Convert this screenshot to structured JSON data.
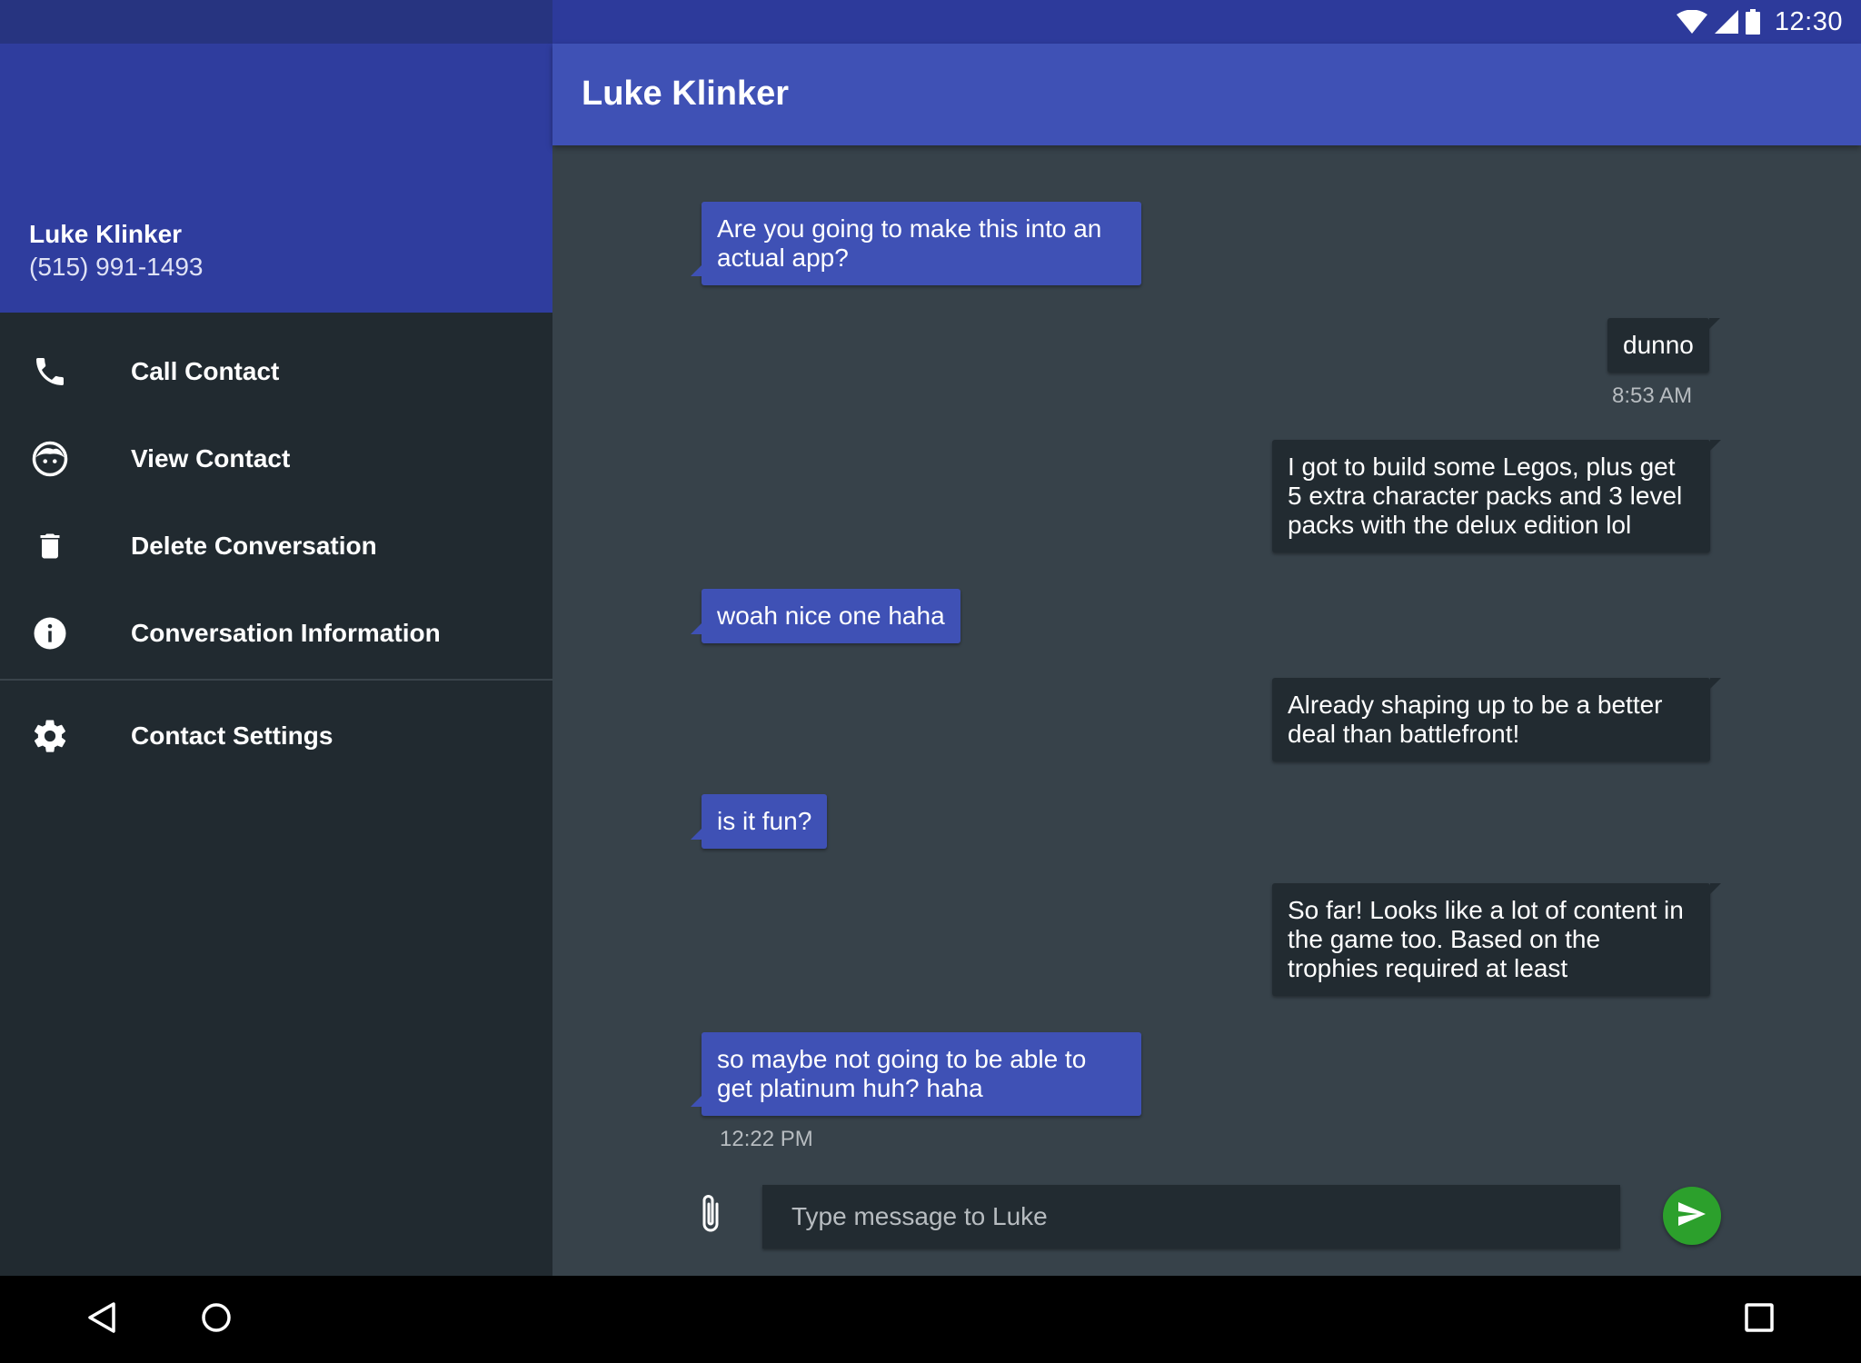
{
  "status_bar": {
    "time": "12:30"
  },
  "drawer": {
    "contact_name": "Luke Klinker",
    "contact_phone": "(515) 991-1493",
    "items": [
      {
        "label": "Call Contact",
        "icon": "phone-icon"
      },
      {
        "label": "View Contact",
        "icon": "face-icon"
      },
      {
        "label": "Delete Conversation",
        "icon": "trash-icon"
      },
      {
        "label": "Conversation Information",
        "icon": "info-icon"
      },
      {
        "label": "Contact Settings",
        "icon": "gear-icon"
      }
    ]
  },
  "toolbar": {
    "title": "Luke Klinker"
  },
  "messages": [
    {
      "direction": "in",
      "text": "Are you going to make this into an actual app?"
    },
    {
      "direction": "out",
      "text": "dunno",
      "timestamp": "8:53 AM"
    },
    {
      "direction": "out",
      "text": "I got to build some Legos, plus get 5 extra character packs and 3 level packs with the delux edition lol"
    },
    {
      "direction": "in",
      "text": "woah nice one haha"
    },
    {
      "direction": "out",
      "text": "Already shaping up to be a better deal than battlefront!"
    },
    {
      "direction": "in",
      "text": "is it fun?"
    },
    {
      "direction": "out",
      "text": "So far! Looks like a lot of content in the game too. Based on the trophies required at least"
    },
    {
      "direction": "in",
      "text": "so maybe not going to be able to get platinum huh? haha",
      "timestamp": "12:22 PM"
    }
  ],
  "composer": {
    "placeholder": "Type message to Luke",
    "attach_icon": "paperclip-icon",
    "send_icon": "send-icon"
  },
  "colors": {
    "primary": "#3f51b5",
    "primary_dark": "#2d3a9b",
    "background": "#37424a",
    "drawer_background": "#212a30",
    "outgoing_bubble": "#222b31",
    "send_button": "#2ca02c"
  }
}
